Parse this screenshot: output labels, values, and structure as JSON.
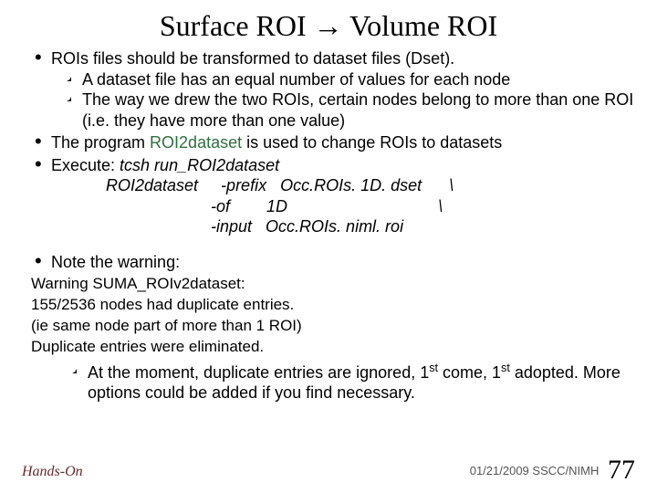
{
  "title_left": "Surface ROI",
  "title_right": "Volume ROI",
  "b1": "ROIs files should be transformed to dataset files (Dset).",
  "b1s1": "A dataset file has an equal number of values for each node",
  "b1s2": "The way we drew the two ROIs, certain nodes belong to more than one ROI (i.e. they have more than one value)",
  "b2a": "The program ",
  "b2prog": "ROI2dataset",
  "b2b": " is used to change ROIs to datasets",
  "b3a": "Execute: ",
  "b3cmd": "tcsh run_ROI2dataset",
  "code1": "ROI2dataset     -prefix   Occ.ROIs. 1D. dset      \\",
  "code2": "                       -of        1D                                 \\",
  "code3": "                       -input   Occ.ROIs. niml. roi",
  "b4": "Note the warning:",
  "w1": "Warning SUMA_ROIv2dataset:",
  "w2": " 155/2536 nodes had duplicate entries.",
  "w3": "(ie same node part of more than 1 ROI)",
  "w4": "Duplicate entries were eliminated.",
  "lasta": "At the moment, duplicate entries are ignored, 1",
  "lastb": " come, 1",
  "lastc": " adopted. More options could be added if you find necessary.",
  "st": "st",
  "footer_left": "Hands-On",
  "footer_date": "01/21/2009",
  "footer_org": "SSCC/NIMH",
  "page": "77"
}
